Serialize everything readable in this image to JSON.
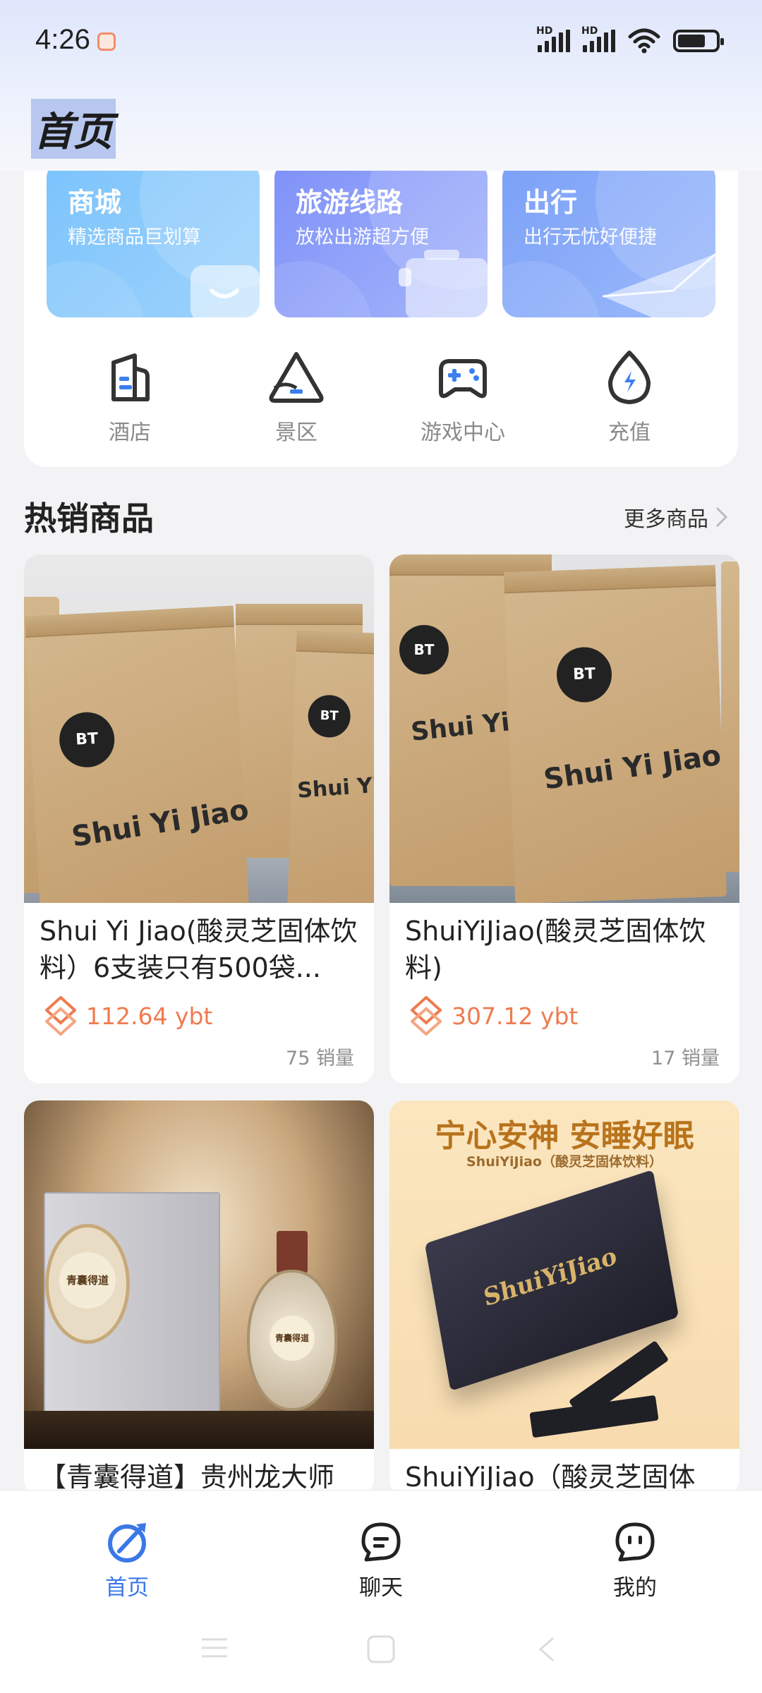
{
  "status_bar": {
    "time": "4:26",
    "network_1": "HD",
    "network_2": "HD"
  },
  "header": {
    "title": "首页"
  },
  "promos": [
    {
      "title": "商城",
      "subtitle": "精选商品巨划算",
      "icon": "shopping-bag-icon"
    },
    {
      "title": "旅游线路",
      "subtitle": "放松出游超方便",
      "icon": "suitcase-icon"
    },
    {
      "title": "出行",
      "subtitle": "出行无忧好便捷",
      "icon": "paper-plane-icon"
    }
  ],
  "quick_links": [
    {
      "label": "酒店",
      "icon": "hotel-icon"
    },
    {
      "label": "景区",
      "icon": "scenic-spot-icon"
    },
    {
      "label": "游戏中心",
      "icon": "gamepad-icon"
    },
    {
      "label": "充值",
      "icon": "recharge-icon"
    }
  ],
  "hot_section": {
    "title": "热销商品",
    "more_label": "更多商品"
  },
  "products": [
    {
      "name": "Shui Yi Jiao(酸灵芝固体饮料）6支装只有500袋...",
      "price": "112.64 ybt",
      "sales": "75 销量"
    },
    {
      "name": "ShuiYiJiao(酸灵芝固体饮料)",
      "price": "307.12 ybt",
      "sales": "17 销量"
    },
    {
      "name": "【青囊得道】贵州龙大师",
      "price": "",
      "sales": ""
    },
    {
      "name": "ShuiYiJiao（酸灵芝固体",
      "price": "",
      "sales": ""
    }
  ],
  "product_images": {
    "bag_text": "Shui Yi Jiao",
    "bag_logo": "BT",
    "banner_line1": "宁心安神 安睡好眠",
    "banner_line2": "ShuiYiJiao（酸灵芝固体饮料）",
    "box_text": "ShuiYiJiao",
    "liquor_label": "青囊得道"
  },
  "bottom_nav": [
    {
      "label": "首页",
      "icon": "home-compass-icon",
      "active": true
    },
    {
      "label": "聊天",
      "icon": "chat-bubble-icon",
      "active": false
    },
    {
      "label": "我的",
      "icon": "profile-face-icon",
      "active": false
    }
  ],
  "colors": {
    "accent": "#3a78e8",
    "price": "#ef7b4f"
  }
}
